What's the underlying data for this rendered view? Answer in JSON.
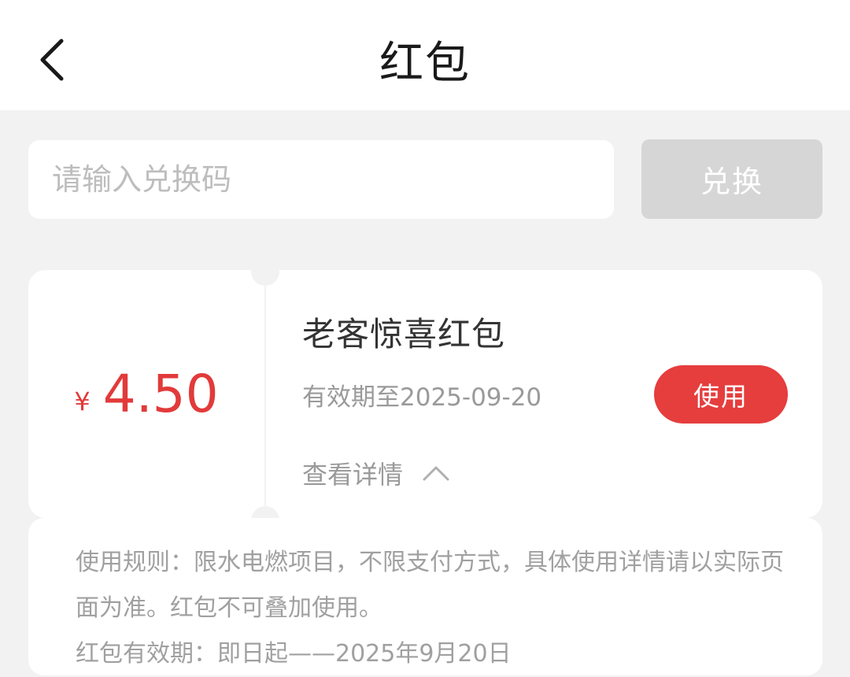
{
  "header": {
    "title": "红包",
    "back_icon": "chevron-left-icon"
  },
  "redeem": {
    "placeholder": "请输入兑换码",
    "value": "",
    "button_label": "兑换"
  },
  "coupon": {
    "currency_symbol": "¥",
    "amount": "4.50",
    "title": "老客惊喜红包",
    "validity": "有效期至2025-09-20",
    "use_button_label": "使用",
    "details_label": "查看详情",
    "details_icon": "chevron-up-icon",
    "accent_color": "#e63d3d"
  },
  "rules": {
    "usage_rules": "使用规则：限水电燃项目，不限支付方式，具体使用详情请以实际页面为准。红包不可叠加使用。",
    "validity_period": "红包有效期：即日起——2025年9月20日"
  }
}
